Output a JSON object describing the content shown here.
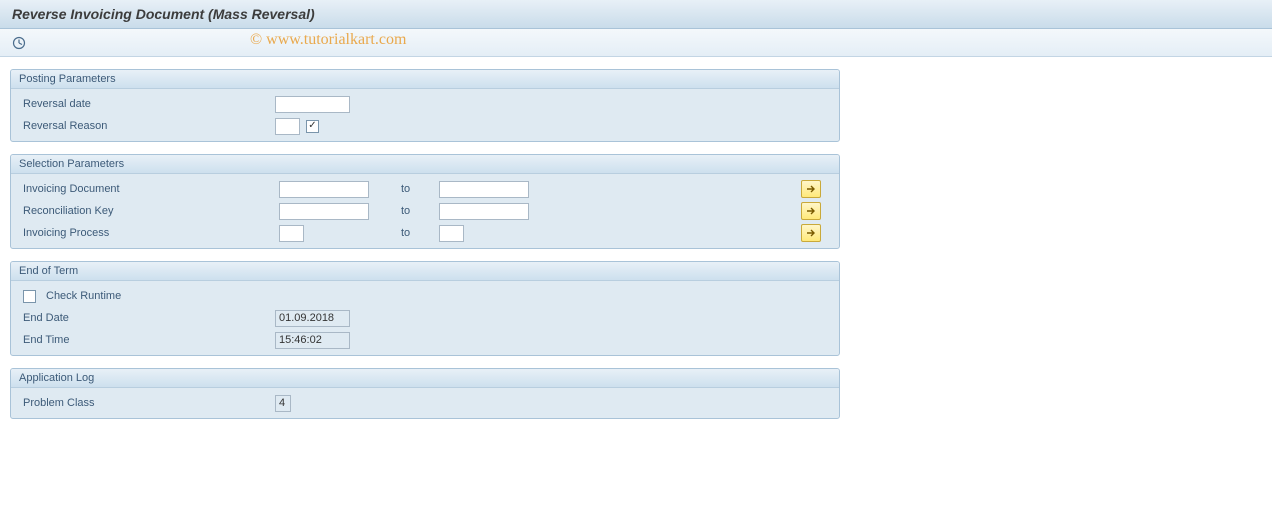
{
  "window": {
    "title": "Reverse Invoicing Document (Mass Reversal)"
  },
  "watermark": "© www.tutorialkart.com",
  "groups": {
    "posting": {
      "title": "Posting Parameters",
      "reversal_date_label": "Reversal date",
      "reversal_date_value": "",
      "reversal_reason_label": "Reversal Reason",
      "reversal_reason_value": ""
    },
    "selection": {
      "title": "Selection Parameters",
      "to_label": "to",
      "invoicing_document_label": "Invoicing Document",
      "invoicing_document_from": "",
      "invoicing_document_to": "",
      "reconciliation_key_label": "Reconciliation Key",
      "reconciliation_key_from": "",
      "reconciliation_key_to": "",
      "invoicing_process_label": "Invoicing Process",
      "invoicing_process_from": "",
      "invoicing_process_to": ""
    },
    "end_of_term": {
      "title": "End of Term",
      "check_runtime_label": "Check Runtime",
      "check_runtime_checked": false,
      "end_date_label": "End Date",
      "end_date_value": "01.09.2018",
      "end_time_label": "End Time",
      "end_time_value": "15:46:02"
    },
    "app_log": {
      "title": "Application Log",
      "problem_class_label": "Problem Class",
      "problem_class_value": "4"
    }
  }
}
